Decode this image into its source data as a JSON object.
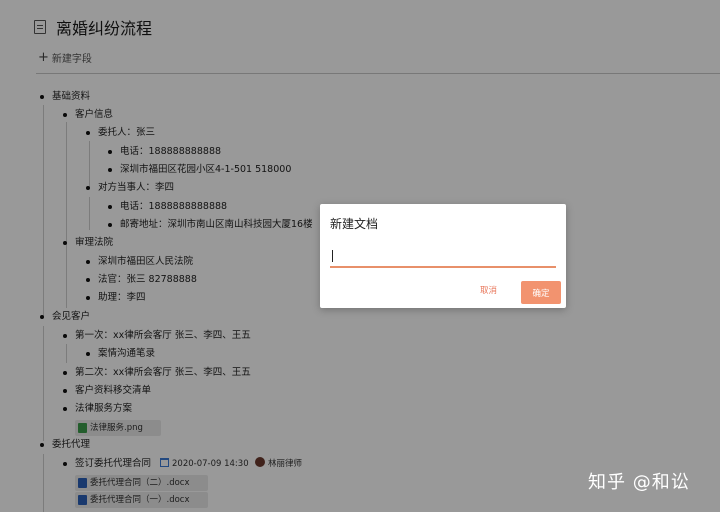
{
  "document": {
    "title": "离婚纠纷流程",
    "new_field_label": "新建字段"
  },
  "outline": [
    {
      "id": "n1",
      "text": "基础资料"
    },
    {
      "id": "n2",
      "text": "客户信息"
    },
    {
      "id": "n3",
      "text": "委托人：张三"
    },
    {
      "id": "n4",
      "text": "电话：188888888888"
    },
    {
      "id": "n5",
      "text": "深圳市福田区花园小区4-1-501 518000"
    },
    {
      "id": "n6",
      "text": "对方当事人：李四"
    },
    {
      "id": "n7",
      "text": "电话：1888888888888"
    },
    {
      "id": "n8",
      "text": "邮寄地址：深圳市南山区南山科技园大厦16楼"
    },
    {
      "id": "n9",
      "text": "审理法院"
    },
    {
      "id": "n10",
      "text": "深圳市福田区人民法院"
    },
    {
      "id": "n11",
      "text": "法官：张三 82788888"
    },
    {
      "id": "n12",
      "text": "助理：李四"
    },
    {
      "id": "n13",
      "text": "会见客户"
    },
    {
      "id": "n14",
      "text": "第一次：xx律所会客厅 张三、李四、王五"
    },
    {
      "id": "n15",
      "text": "案情沟通笔录"
    },
    {
      "id": "n16",
      "text": "第二次：xx律所会客厅 张三、李四、王五"
    },
    {
      "id": "n17",
      "text": "客户资料移交清单"
    },
    {
      "id": "n18",
      "text": "法律服务方案"
    },
    {
      "id": "n19",
      "text": "委托代理"
    },
    {
      "id": "n20",
      "text": "签订委托代理合同"
    }
  ],
  "attachments": {
    "legal_service_png": "法律服务.png",
    "contract_2": "委托代理合同（二）.docx",
    "contract_1": "委托代理合同（一）.docx"
  },
  "contract_meta": {
    "date": "2020-07-09 14:30",
    "assignee": "林丽律师"
  },
  "dialog": {
    "title": "新建文档",
    "input_value": "",
    "cancel_label": "取消",
    "confirm_label": "确定"
  },
  "watermark": "知乎 @和讼",
  "colors": {
    "accent": "#f2936f",
    "cancel_text": "#e8765a",
    "overlay": "rgba(0,0,0,0.40)"
  }
}
